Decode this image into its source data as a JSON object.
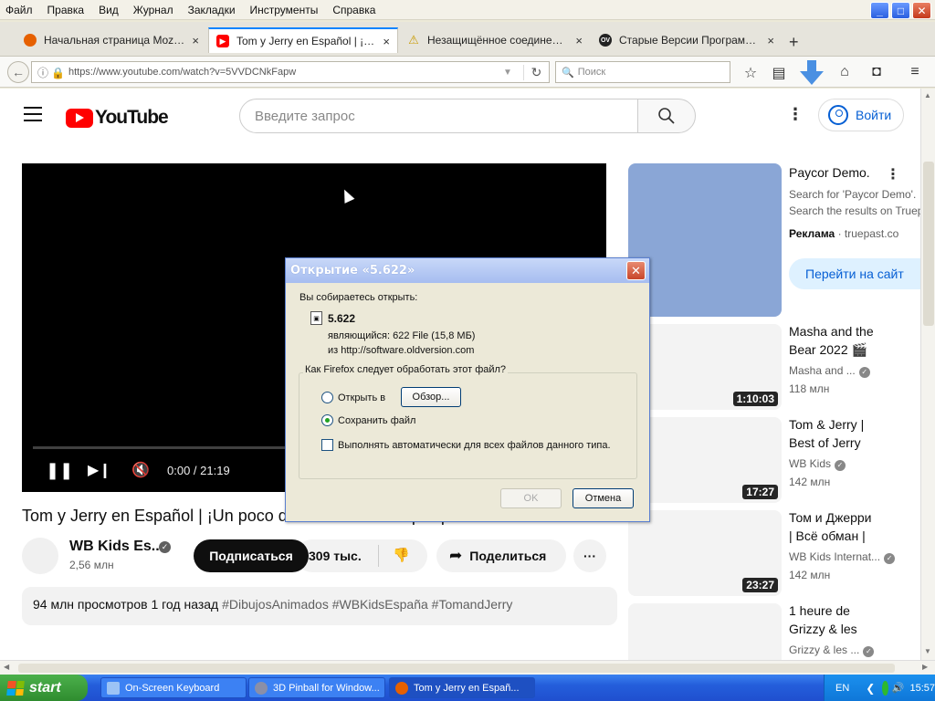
{
  "menu": [
    "Файл",
    "Правка",
    "Вид",
    "Журнал",
    "Закладки",
    "Инструменты",
    "Справка"
  ],
  "window_controls": {
    "minimize": "_",
    "maximize": "□",
    "close": "✕"
  },
  "tabs": [
    {
      "title": "Начальная страница Mozilla ...",
      "icon_color": "#e66000",
      "active": false
    },
    {
      "title": "Tom y Jerry en Español | ¡Un ...",
      "icon_color": "#ff0000",
      "active": true
    },
    {
      "title": "Незащищённое соединение",
      "icon_color": "#f0c000",
      "active": false
    },
    {
      "title": "Старые Версии Программно...",
      "icon_color": "#222222",
      "active": false
    }
  ],
  "tab_close": "×",
  "new_tab": "+",
  "nav": {
    "url": "https://www.youtube.com/watch?v=5VVDCNkFapw",
    "search_placeholder": "Поиск"
  },
  "youtube": {
    "logo_text": "YouTube",
    "search_placeholder": "Введите запрос",
    "login_label": "Войти",
    "video": {
      "time": "0:00 / 21:19",
      "title": "Tom y Jerry en Español | ¡Un poco de diversión en el parque!",
      "channel": "WB Kids Es...",
      "subscribers": "2,56 млн",
      "subscribe_label": "Подписаться",
      "likes": "309 тыс.",
      "share_label": "Поделиться",
      "desc_stats": "94 млн просмотров  1 год назад",
      "desc_tags": "#DibujosAnimados #WBKidsEspaña #TomandJerry"
    },
    "ad": {
      "title": "Paycor Demo.",
      "line1": "Search for 'Paycor Demo'.",
      "line2": "Search the results on Truep",
      "label": "Реклама",
      "domain": "truepast.co",
      "cta": "Перейти на сайт"
    },
    "recommendations": [
      {
        "line1": "Masha and the",
        "line2": "Bear 2022 🎬",
        "channel": "Masha and ...",
        "views": "118 млн",
        "duration": "1:10:03"
      },
      {
        "line1": "Tom & Jerry |",
        "line2": "Best of Jerry",
        "channel": "WB Kids",
        "views": "142 млн",
        "duration": "17:27"
      },
      {
        "line1": "Том и Джерри",
        "line2": "| Всё обман |",
        "channel": "WB Kids Internat...",
        "views": "142 млн",
        "duration": "23:27"
      },
      {
        "line1": "1 heure de",
        "line2": "Grizzy & les",
        "channel": "Grizzy & les ...",
        "views": "",
        "duration": ""
      }
    ]
  },
  "dialog": {
    "title": "Открытие «5.622»",
    "about_to_open": "Вы собираетесь открыть:",
    "file_name": "5.622",
    "file_type": "являющийся:  622 File (15,8 МБ)",
    "file_source": "из  http://software.oldversion.com",
    "question": "Как Firefox следует обработать этот файл?",
    "open_with_label": "Открыть в",
    "browse_label": "Обзор...",
    "save_label": "Сохранить файл",
    "auto_label": "Выполнять автоматически для всех файлов данного типа.",
    "ok_label": "OK",
    "cancel_label": "Отмена",
    "selected": "save"
  },
  "taskbar": {
    "start_label": "start",
    "tasks": [
      {
        "label": "On-Screen Keyboard",
        "active": false
      },
      {
        "label": "3D Pinball for Window...",
        "active": false
      },
      {
        "label": "Tom y Jerry en Españ...",
        "active": true
      }
    ],
    "lang": "EN",
    "clock": "15:57"
  }
}
